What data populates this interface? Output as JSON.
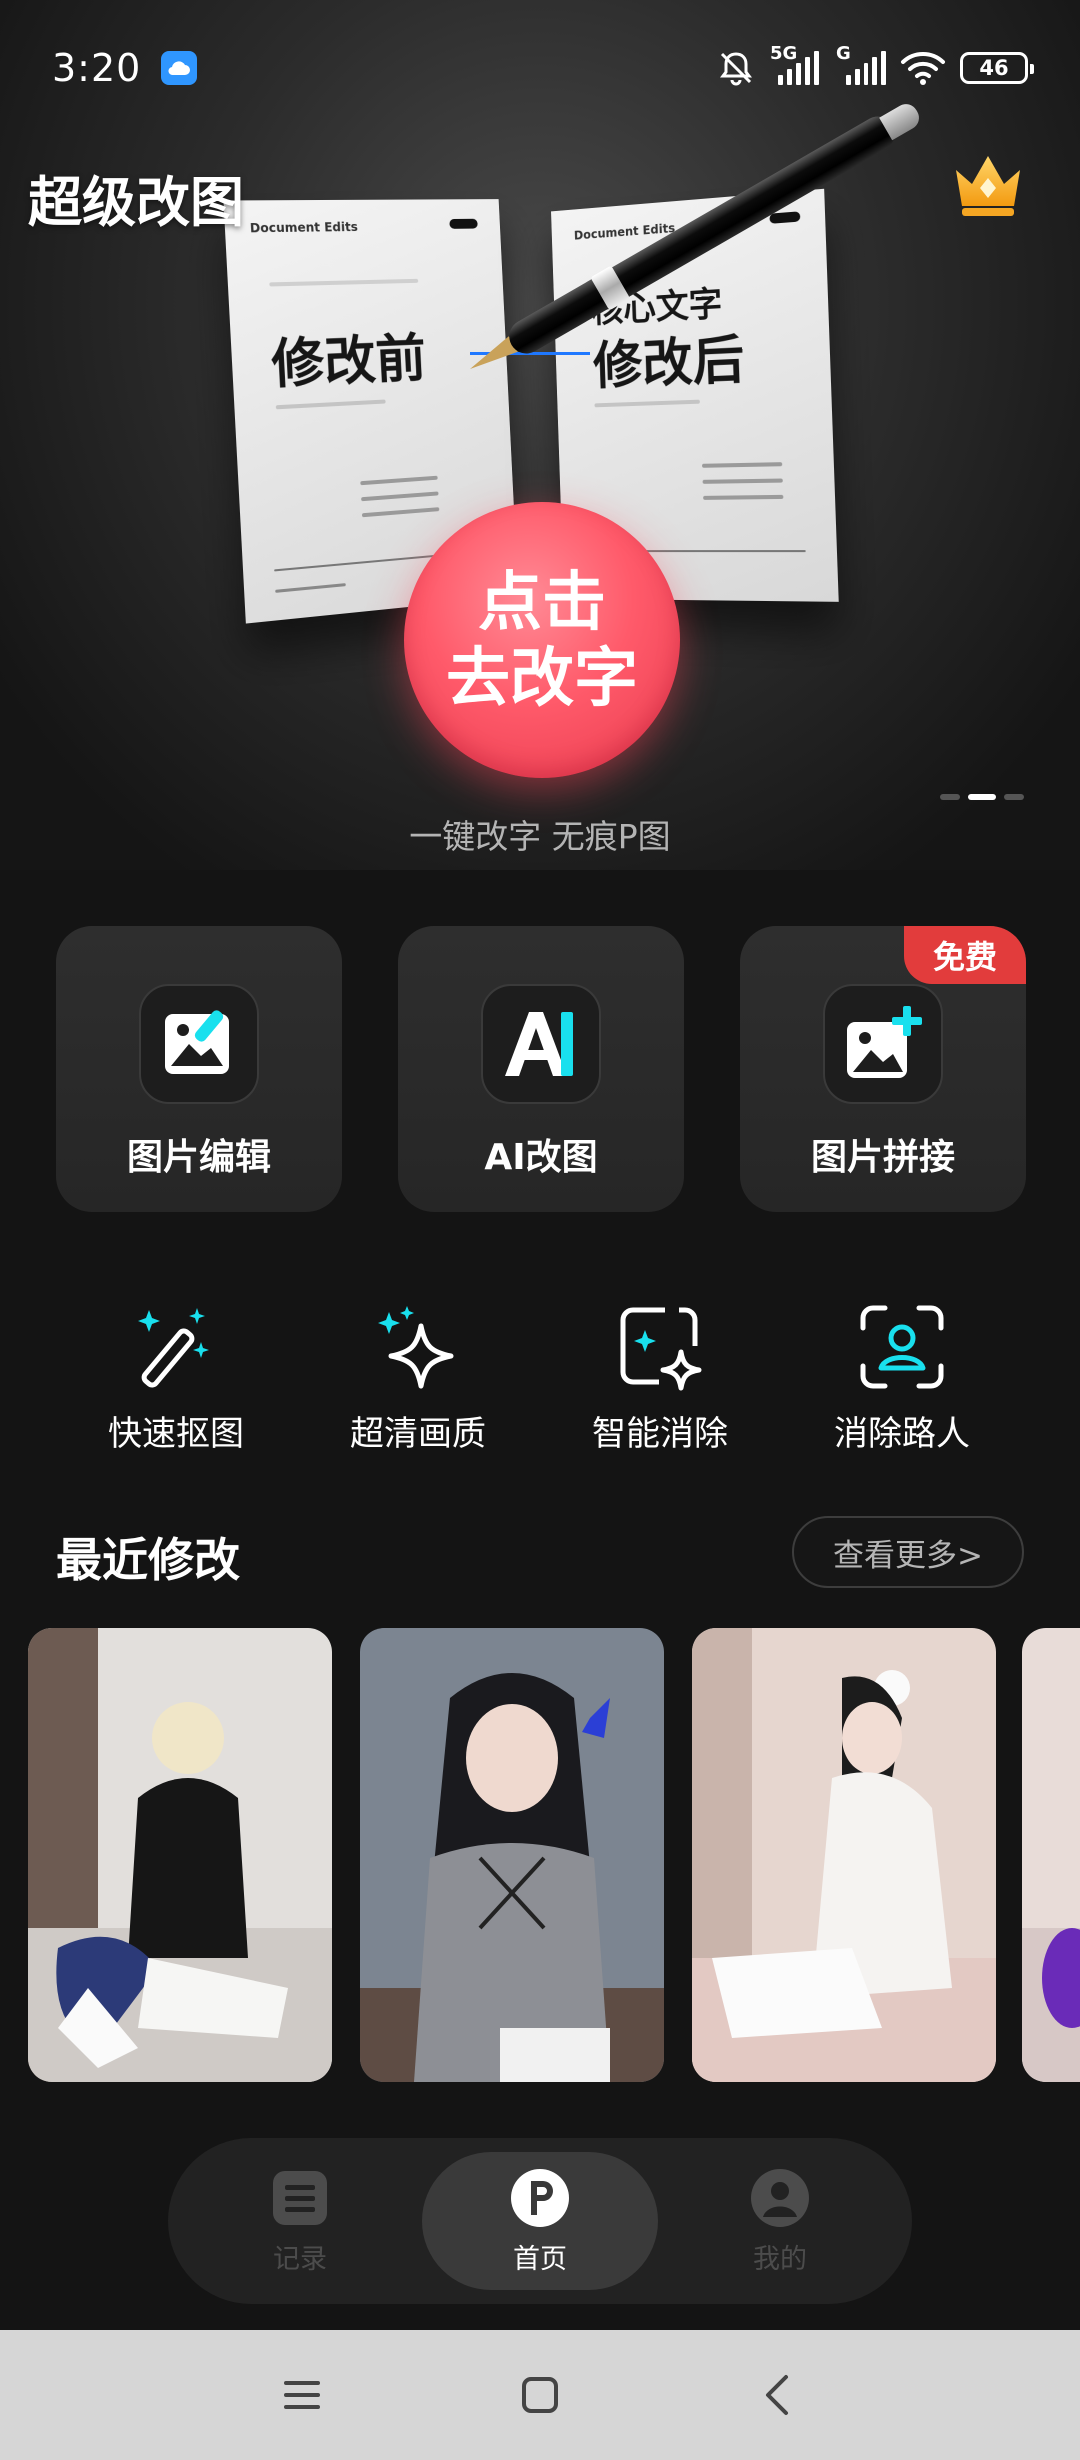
{
  "status_bar": {
    "time": "3:20",
    "network_1": "5G",
    "network_2": "G",
    "battery": "46",
    "icons": [
      "cloud-icon",
      "mute-icon",
      "signal-icon",
      "wifi-icon",
      "battery-icon"
    ]
  },
  "hero": {
    "app_title": "超级改图",
    "paper_left_text": "修改前",
    "paper_right_small": "核心文字",
    "paper_right_text": "修改后",
    "cta_line1": "点击",
    "cta_line2": "去改字",
    "caption": "一键改字 无痕P图",
    "slide_index": 2,
    "slide_count": 3
  },
  "feature_cards": [
    {
      "label": "图片编辑",
      "icon": "image-edit-icon"
    },
    {
      "label": "AI改图",
      "icon": "ai-icon"
    },
    {
      "label": "图片拼接",
      "icon": "image-add-icon",
      "badge": "免费"
    }
  ],
  "tools": [
    {
      "label": "快速抠图",
      "icon": "magic-wand-icon"
    },
    {
      "label": "超清画质",
      "icon": "sparkle-icon"
    },
    {
      "label": "智能消除",
      "icon": "smart-erase-icon"
    },
    {
      "label": "消除路人",
      "icon": "person-scan-icon"
    }
  ],
  "recent": {
    "title": "最近修改",
    "more_label": "查看更多>"
  },
  "bottom_nav": [
    {
      "label": "记录",
      "icon": "records-icon",
      "active": false
    },
    {
      "label": "首页",
      "icon": "home-p-icon",
      "active": true
    },
    {
      "label": "我的",
      "icon": "profile-icon",
      "active": false
    }
  ],
  "colors": {
    "accent_cyan": "#19e0ee",
    "cta_red": "#ff5a6a",
    "badge_red": "#e23c3c",
    "background": "#141414"
  }
}
